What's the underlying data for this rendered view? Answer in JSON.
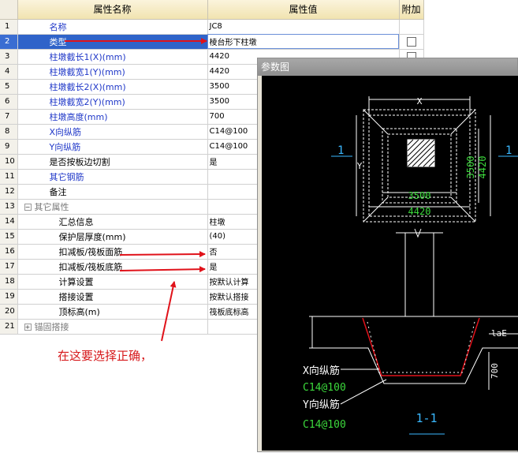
{
  "grid": {
    "headers": {
      "name": "属性名称",
      "value": "属性值",
      "extra": "附加"
    },
    "rows": [
      {
        "num": "1",
        "name": "名称",
        "value": "JC8",
        "checkbox": false
      },
      {
        "num": "2",
        "name": "类型",
        "value": "棱台形下柱墩",
        "checkbox": true
      },
      {
        "num": "3",
        "name": "柱墩截长1(X)(mm)",
        "value": "4420",
        "checkbox": true
      },
      {
        "num": "4",
        "name": "柱墩截宽1(Y)(mm)",
        "value": "4420",
        "checkbox": false
      },
      {
        "num": "5",
        "name": "柱墩截长2(X)(mm)",
        "value": "3500",
        "checkbox": false
      },
      {
        "num": "6",
        "name": "柱墩截宽2(Y)(mm)",
        "value": "3500",
        "checkbox": false
      },
      {
        "num": "7",
        "name": "柱墩高度(mm)",
        "value": "700",
        "checkbox": false
      },
      {
        "num": "8",
        "name": "X向纵筋",
        "value": "C14@100",
        "checkbox": false
      },
      {
        "num": "9",
        "name": "Y向纵筋",
        "value": "C14@100",
        "checkbox": false
      },
      {
        "num": "10",
        "name": "是否按板边切割",
        "value": "是",
        "checkbox": false
      },
      {
        "num": "11",
        "name": "其它钢筋",
        "value": "",
        "checkbox": false
      },
      {
        "num": "12",
        "name": "备注",
        "value": "",
        "checkbox": false
      },
      {
        "num": "13",
        "name": "其它属性",
        "value": "",
        "checkbox": false,
        "toggle": "−"
      },
      {
        "num": "14",
        "name": "汇总信息",
        "value": "柱墩",
        "checkbox": false
      },
      {
        "num": "15",
        "name": "保护层厚度(mm)",
        "value": "(40)",
        "checkbox": false
      },
      {
        "num": "16",
        "name": "扣减板/筏板面筋",
        "value": "否",
        "checkbox": false
      },
      {
        "num": "17",
        "name": "扣减板/筏板底筋",
        "value": "是",
        "checkbox": false
      },
      {
        "num": "18",
        "name": "计算设置",
        "value": "按默认计算",
        "checkbox": false
      },
      {
        "num": "19",
        "name": "搭接设置",
        "value": "按默认搭接",
        "checkbox": false
      },
      {
        "num": "20",
        "name": "顶标高(m)",
        "value": "筏板底标高",
        "checkbox": false
      },
      {
        "num": "21",
        "name": "锚固搭接",
        "value": "",
        "checkbox": false,
        "toggle": "+"
      }
    ]
  },
  "param_window": {
    "title": "参数图",
    "plan": {
      "x_label": "X",
      "y_label": "Y",
      "inner_w": "3500",
      "outer_w": "4420",
      "inner_h": "3500",
      "outer_h": "4420",
      "mark": "1"
    },
    "section": {
      "lae": "laE",
      "height": "700",
      "x_bar_label": "X向纵筋",
      "x_bar_value": "C14@100",
      "y_bar_label": "Y向纵筋",
      "y_bar_value": "C14@100",
      "section_title": "1-1"
    }
  },
  "annotation": {
    "text": "在这要选择正确，"
  },
  "colors": {
    "selection": "#2f63c9",
    "blue_text": "#1f37c8",
    "arrow": "#e0121a",
    "cad_green": "#3cd93c",
    "cad_cyan": "#3ab8ff",
    "cad_white": "#ffffff"
  }
}
